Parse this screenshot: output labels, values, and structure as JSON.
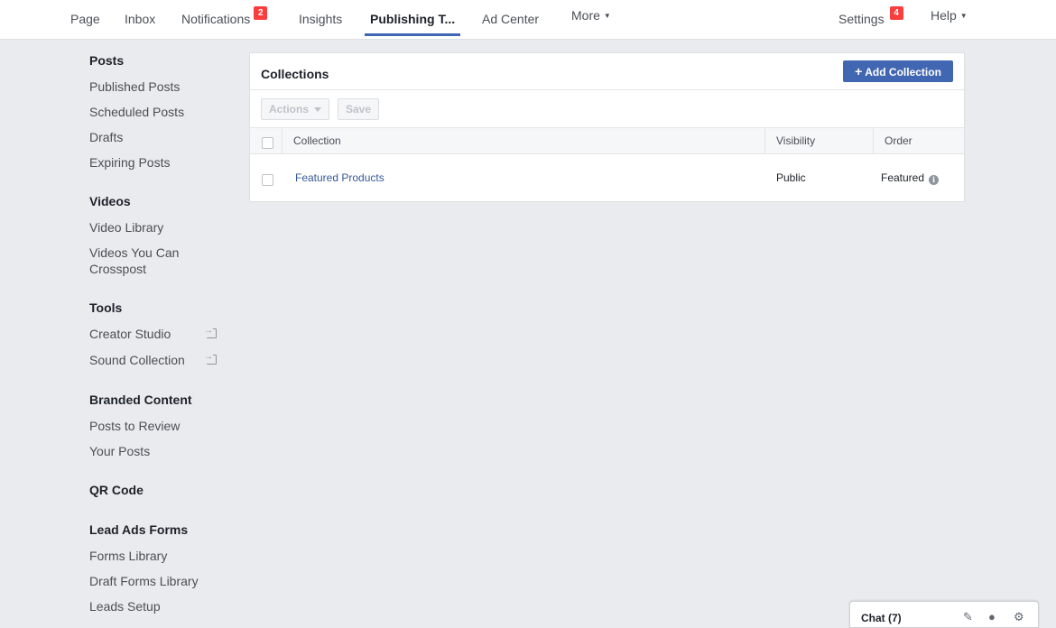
{
  "topnav": {
    "items": [
      {
        "label": "Page"
      },
      {
        "label": "Inbox"
      },
      {
        "label": "Notifications",
        "badge": "2"
      },
      {
        "label": "Insights"
      },
      {
        "label": "Publishing T..."
      },
      {
        "label": "Ad Center"
      },
      {
        "label": "More"
      }
    ],
    "right": [
      {
        "label": "Settings",
        "badge": "4"
      },
      {
        "label": "Help"
      }
    ],
    "active": "Publishing T..."
  },
  "sidebar": {
    "sections": [
      {
        "title": "Posts",
        "items": [
          "Published Posts",
          "Scheduled Posts",
          "Drafts",
          "Expiring Posts"
        ]
      },
      {
        "title": "Videos",
        "items": [
          "Video Library",
          "Videos You Can Crosspost"
        ]
      },
      {
        "title": "Tools",
        "items": [
          "Creator Studio",
          "Sound Collection"
        ]
      },
      {
        "title": "Branded Content",
        "items": [
          "Posts to Review",
          "Your Posts"
        ]
      },
      {
        "title": "QR Code",
        "items": []
      },
      {
        "title": "Lead Ads Forms",
        "items": [
          "Forms Library",
          "Draft Forms Library",
          "Leads Setup"
        ]
      }
    ]
  },
  "main": {
    "title": "Collections",
    "add_button": "Add Collection",
    "actions_button": "Actions",
    "save_button": "Save",
    "columns": [
      "Collection",
      "Visibility",
      "Order"
    ],
    "rows": [
      {
        "collection": "Featured Products",
        "visibility": "Public",
        "order": "Featured"
      }
    ]
  },
  "chat": {
    "title": "Chat (7)"
  },
  "colors": {
    "accent": "#4267b2",
    "badge": "#fa3e3e",
    "link": "#365899",
    "background": "#e9ebee"
  }
}
